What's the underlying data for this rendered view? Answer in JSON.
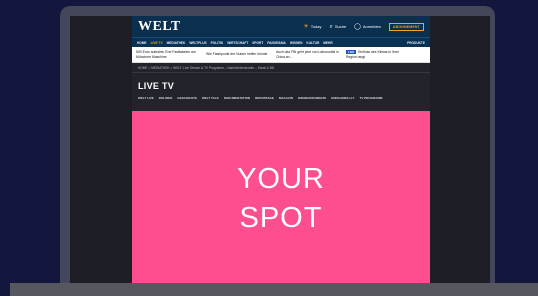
{
  "header": {
    "logo": "WELT",
    "weather": "Today",
    "search": "Suche",
    "login": "Anmelden",
    "abo": "ABONNEMENT"
  },
  "nav": {
    "items": [
      "HOME",
      "LIVE TV",
      "MEDIATHEK",
      "WELTPLUS",
      "POLITIK",
      "WIRTSCHAFT",
      "SPORT",
      "PANORAMA",
      "WISSEN",
      "KULTUR",
      "MEHR"
    ],
    "active_index": 1,
    "right": "PRODUKTE"
  },
  "news": [
    {
      "text": "500 Euro aufwärts: Erst Fastfabelen am Münchner Maschine"
    },
    {
      "text": "Wie Flashpunkt der Nutzer helfen könnte"
    },
    {
      "text": "Auch das FBI geht jetzt von Laborunfall in China an..."
    },
    {
      "badge": "LIVE",
      "text": "Einfluss des Klimas in Ihrer Region langt"
    }
  ],
  "breadcrumb": "HOME  >  MEDIATHEK  >  WELT: Live Stream & TV Programm – Nachrichtensender – Kanal & Mit",
  "live_tv": {
    "title": "LIVE TV",
    "tabs": [
      "WELT LIVE",
      "BOLIDEN",
      "GESCHICHTE",
      "WELT TALK",
      "DOKUMENTATION",
      "REPORTAGE",
      "MAGAZIN",
      "WISSENSFORMATE",
      "ENDGAMES H-T",
      "TV PROGRAMM"
    ]
  },
  "ad": {
    "line1": "YOUR",
    "line2": "SPOT",
    "color": "#fd4f8f"
  },
  "colors": {
    "background": "#13173d",
    "site_header": "#0b2f4e",
    "accent": "#f3a51b"
  }
}
